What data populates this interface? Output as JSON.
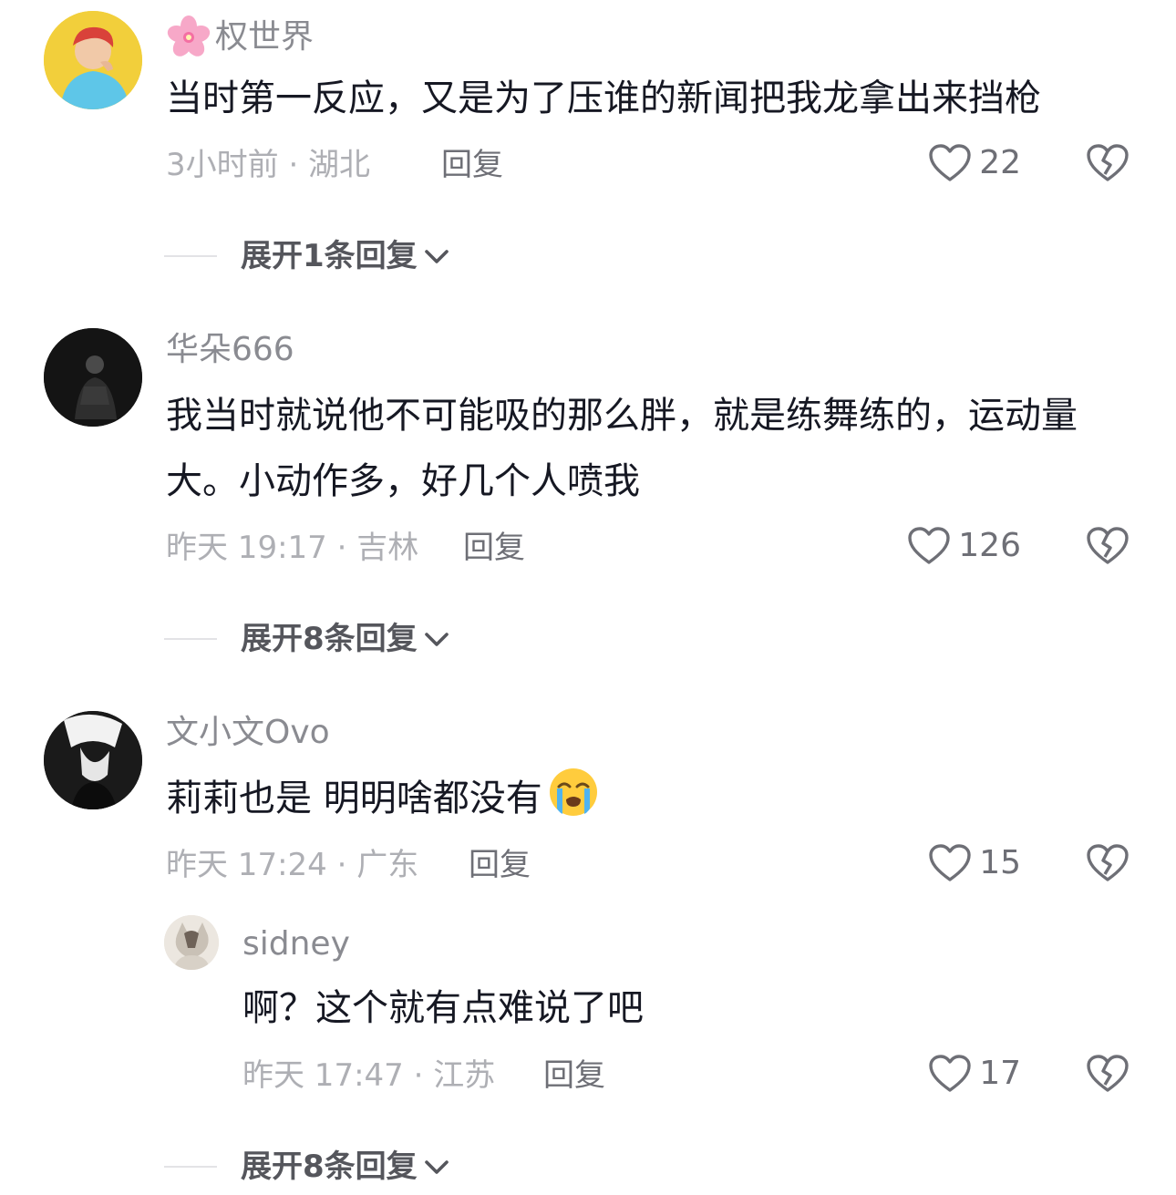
{
  "comments": [
    {
      "username": "权世界",
      "name_prefix_icon": "cherry-blossom-emoji",
      "text": "当时第一反应，又是为了压谁的新闻把我龙拿出来挡枪",
      "meta": "3小时前 · 湖北",
      "reply_label": "回复",
      "likes": "22",
      "expand_label": "展开1条回复"
    },
    {
      "username": "华朵666",
      "text": "我当时就说他不可能吸的那么胖，就是练舞练的，运动量大。小动作多，好几个人喷我",
      "meta": "昨天 19:17 · 吉林",
      "reply_label": "回复",
      "likes": "126",
      "expand_label": "展开8条回复"
    },
    {
      "username": "文小文Ovo",
      "text": "莉莉也是 明明啥都没有",
      "text_suffix_icon": "loudly-crying-face-emoji",
      "meta": "昨天 17:24 · 广东",
      "reply_label": "回复",
      "likes": "15",
      "reply": {
        "username": "sidney",
        "text": "啊？这个就有点难说了吧",
        "meta": "昨天 17:47 · 江苏",
        "reply_label": "回复",
        "likes": "17"
      },
      "expand_label": "展开8条回复"
    }
  ],
  "colors": {
    "text": "#161823",
    "username": "#8a8b91",
    "meta": "#aeafb4",
    "action": "#6e6f76"
  }
}
